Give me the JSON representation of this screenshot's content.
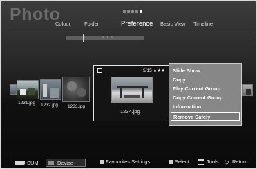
{
  "header": {
    "title": "Photo",
    "tabs": [
      "Colour",
      "Folder",
      "Preference",
      "Basic View",
      "Timeline"
    ]
  },
  "thumbnails": [
    {
      "name": "1231.jpg"
    },
    {
      "name": "1232.jpg"
    },
    {
      "name": "1233.jpg"
    },
    {
      "name": "1234.jpg"
    }
  ],
  "selected": {
    "page": "5/15",
    "rating": "★★★"
  },
  "context_menu": {
    "items": [
      "Slide Show",
      "Copy",
      "Play Current Group",
      "Copy Current Group",
      "Information",
      "Remove Safely"
    ]
  },
  "bottom_bar": {
    "device_label": "SUM",
    "device_button": "Device",
    "favourites": "Favourites Settings",
    "select": "Select",
    "tools": "Tools",
    "return": "Return"
  },
  "colors": {
    "background_top": "#3c3c3c",
    "menu_bg": "#878787",
    "active_tab": "#ffffff",
    "device_button": "#8e8e8e"
  }
}
